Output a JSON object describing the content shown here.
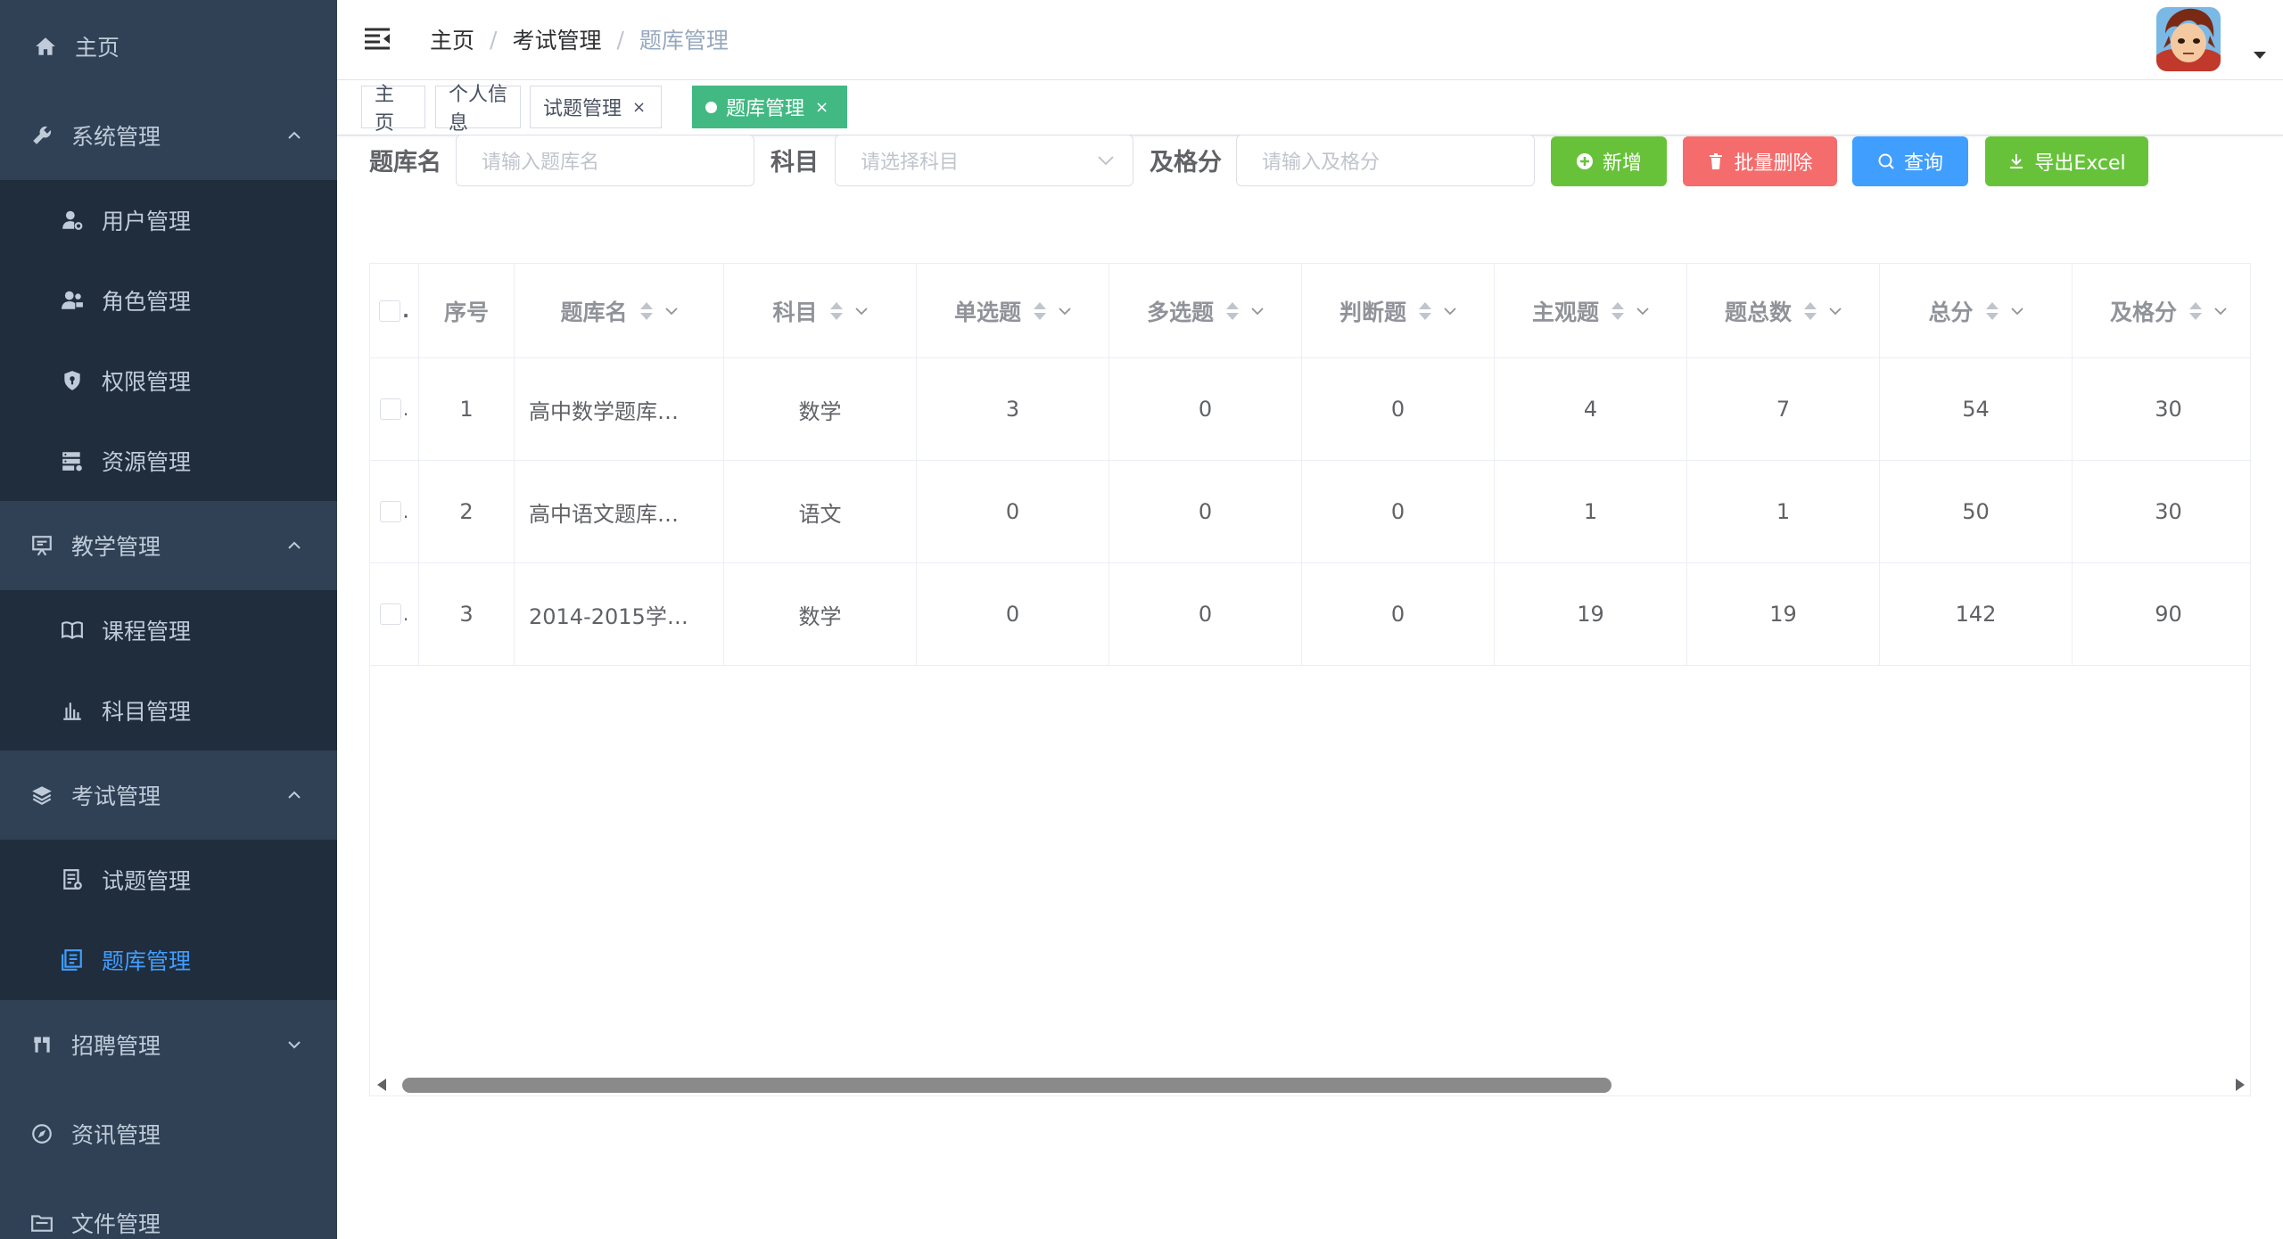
{
  "sidebar": {
    "home": "主页",
    "system": "系统管理",
    "system_items": [
      "用户管理",
      "角色管理",
      "权限管理",
      "资源管理"
    ],
    "teaching": "教学管理",
    "teaching_items": [
      "课程管理",
      "科目管理"
    ],
    "exam": "考试管理",
    "exam_items": [
      "试题管理",
      "题库管理"
    ],
    "recruit": "招聘管理",
    "news": "资讯管理",
    "files": "文件管理"
  },
  "breadcrumb": [
    "主页",
    "考试管理",
    "题库管理"
  ],
  "tags": [
    {
      "label": "主页"
    },
    {
      "label": "个人信息"
    },
    {
      "label": "试题管理"
    },
    {
      "label": "题库管理"
    }
  ],
  "tag_close": "×",
  "search": {
    "name_label": "题库名",
    "name_placeholder": "请输入题库名",
    "subject_label": "科目",
    "subject_placeholder": "请选择科目",
    "pass_label": "及格分",
    "pass_placeholder": "请输入及格分"
  },
  "buttons": {
    "add": "新增",
    "batch_delete": "批量删除",
    "query": "查询",
    "export": "导出Excel"
  },
  "table": {
    "columns": [
      "序号",
      "题库名",
      "科目",
      "单选题",
      "多选题",
      "判断题",
      "主观题",
      "题总数",
      "总分",
      "及格分"
    ],
    "rows": [
      [
        "1",
        "高中数学题库…",
        "数学",
        "3",
        "0",
        "0",
        "4",
        "7",
        "54",
        "30"
      ],
      [
        "2",
        "高中语文题库…",
        "语文",
        "0",
        "0",
        "0",
        "1",
        "1",
        "50",
        "30"
      ],
      [
        "3",
        "2014-2015学…",
        "数学",
        "0",
        "0",
        "0",
        "19",
        "19",
        "142",
        "90"
      ]
    ]
  },
  "colors": {
    "sidebar_bg": "#304156",
    "submenu_bg": "#1f2d3d",
    "active_menu": "#409eff",
    "active_tag": "#42b983",
    "success": "#67c23a",
    "danger": "#f56c6c",
    "primary": "#409eff"
  }
}
